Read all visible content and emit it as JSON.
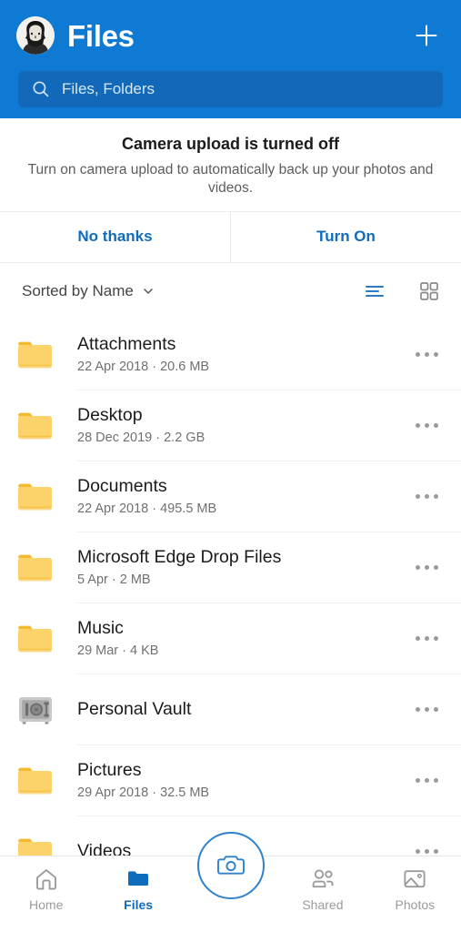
{
  "header": {
    "title": "Files",
    "avatar_icon": "user-portrait-avatar",
    "add_icon": "plus-icon",
    "search": {
      "placeholder": "Files, Folders",
      "value": "",
      "icon": "search-icon"
    },
    "background_color": "#0f7ad4",
    "search_background_color": "#1269b9"
  },
  "banner": {
    "title": "Camera upload is turned off",
    "subtitle": "Turn on camera upload to automatically back up your photos and videos.",
    "decline_label": "No thanks",
    "accept_label": "Turn On",
    "link_color": "#0f6cbd"
  },
  "sortbar": {
    "sort_label": "Sorted by Name",
    "chevron_icon": "chevron-down-icon",
    "list_view_icon": "list-view-icon",
    "grid_view_icon": "grid-view-icon",
    "active_view": "list",
    "active_color": "#2a7ac4",
    "inactive_color": "#8a8a8a"
  },
  "files": [
    {
      "name": "Attachments",
      "meta": "22 Apr 2018 · 20.6 MB",
      "icon": "folder-icon",
      "more_icon": "more-options-icon"
    },
    {
      "name": "Desktop",
      "meta": "28 Dec 2019 · 2.2 GB",
      "icon": "folder-icon",
      "more_icon": "more-options-icon"
    },
    {
      "name": "Documents",
      "meta": "22 Apr 2018 · 495.5 MB",
      "icon": "folder-icon",
      "more_icon": "more-options-icon"
    },
    {
      "name": "Microsoft Edge Drop Files",
      "meta": "5 Apr · 2 MB",
      "icon": "folder-icon",
      "more_icon": "more-options-icon"
    },
    {
      "name": "Music",
      "meta": "29 Mar · 4 KB",
      "icon": "folder-icon",
      "more_icon": "more-options-icon"
    },
    {
      "name": "Personal Vault",
      "meta": "",
      "icon": "vault-safe-icon",
      "more_icon": "more-options-icon"
    },
    {
      "name": "Pictures",
      "meta": "29 Apr 2018 · 32.5 MB",
      "icon": "folder-icon",
      "more_icon": "more-options-icon"
    },
    {
      "name": "Videos",
      "meta": "",
      "icon": "folder-icon",
      "more_icon": "more-options-icon"
    }
  ],
  "folder_colors": {
    "tab": "#f5b92d",
    "body": "#fcd36a"
  },
  "bottomnav": {
    "items": [
      {
        "label": "Home",
        "icon": "home-icon",
        "active": false
      },
      {
        "label": "Files",
        "icon": "folder-filled-icon",
        "active": true
      },
      {
        "label": "Shared",
        "icon": "people-icon",
        "active": false
      },
      {
        "label": "Photos",
        "icon": "photo-icon",
        "active": false
      }
    ],
    "fab_icon": "camera-icon",
    "active_color": "#0f6cbd",
    "inactive_color": "#9b9b9b"
  }
}
